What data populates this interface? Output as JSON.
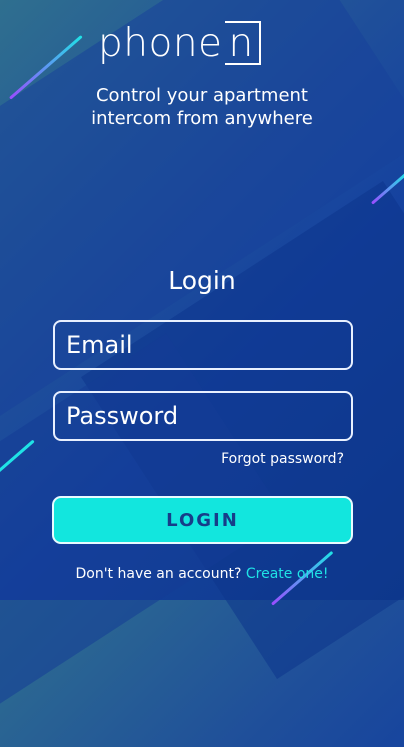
{
  "brand": {
    "logo_text": "phone",
    "logo_box_letter": "n",
    "tagline_line1": "Control your apartment",
    "tagline_line2": "intercom from anywhere"
  },
  "login": {
    "title": "Login",
    "email_placeholder": "Email",
    "password_placeholder": "Password",
    "forgot_label": "Forgot password?",
    "button_label": "LOGIN",
    "signup_prompt": "Don't have an account?",
    "signup_link": "Create one!"
  },
  "colors": {
    "accent": "#12e6de",
    "link": "#1fe3e6",
    "background": "#1f4f9a",
    "button_text": "#173d89"
  }
}
